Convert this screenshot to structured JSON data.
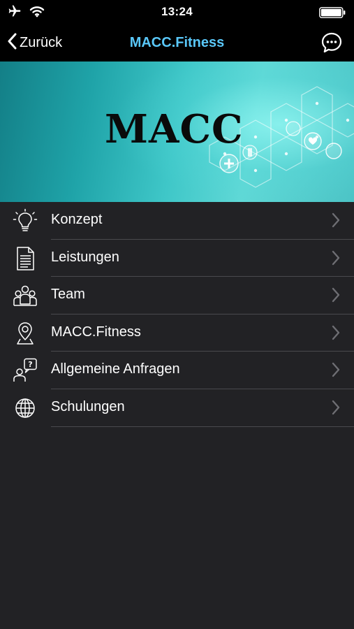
{
  "status_bar": {
    "time": "13:24",
    "icons": [
      "airplane-icon",
      "wifi-icon",
      "battery-icon"
    ]
  },
  "nav": {
    "back_label": "Zurück",
    "title": "MACC.Fitness",
    "title_color": "#5ac8fa",
    "right_icon": "chat-bubble-icon"
  },
  "banner": {
    "wordmark": "MACC"
  },
  "menu": {
    "items": [
      {
        "label": "Konzept",
        "icon": "lightbulb-icon"
      },
      {
        "label": "Leistungen",
        "icon": "document-icon"
      },
      {
        "label": "Team",
        "icon": "team-icon"
      },
      {
        "label": "MACC.Fitness",
        "icon": "location-pin-icon"
      },
      {
        "label": "Allgemeine Anfragen",
        "icon": "question-person-icon"
      },
      {
        "label": "Schulungen",
        "icon": "globe-icon"
      }
    ]
  }
}
